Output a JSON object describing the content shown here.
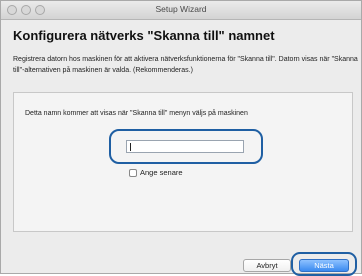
{
  "window": {
    "title": "Setup Wizard"
  },
  "page": {
    "heading": "Konfigurera nätverks \"Skanna till\" namnet",
    "description": "Registrera datorn hos maskinen för att aktivera nätverksfunktionerna för \"Skanna till\". Datorn visas när \"Skanna till\"-alternativen på maskinen är valda. (Rekommenderas.)"
  },
  "panel": {
    "info_text": "Detta namn kommer att visas när \"Skanna till\" menyn väljs på maskinen",
    "name_field_value": "",
    "checkbox_label": "Ange senare",
    "checkbox_checked": false
  },
  "footer": {
    "cancel_label": "Avbryt",
    "next_label": "Nästa"
  },
  "colors": {
    "highlight_ring": "#1f5fa3",
    "primary_button": "#3a8af0"
  }
}
